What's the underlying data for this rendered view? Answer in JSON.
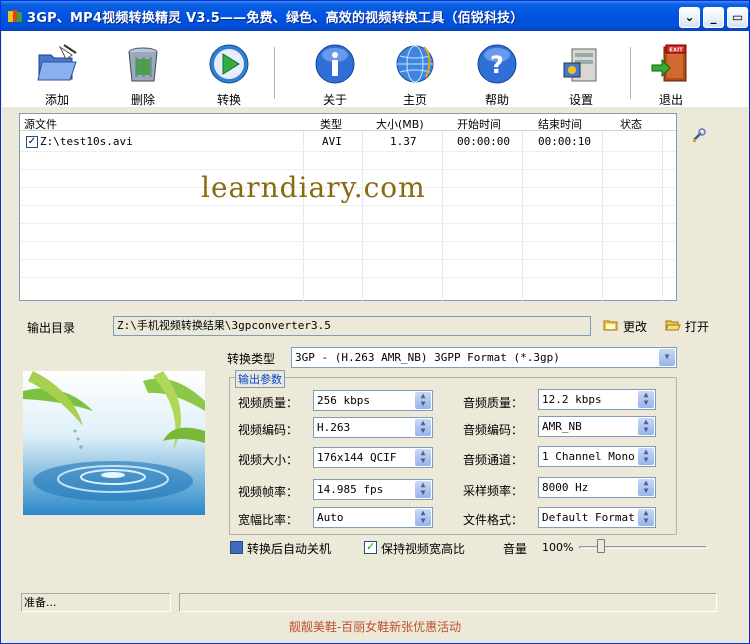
{
  "window": {
    "title": "3GP、MP4视频转换精灵 V3.5——免费、绿色、高效的视频转换工具（佰锐科技）",
    "controls": [
      "chevron-down",
      "minimize",
      "close"
    ]
  },
  "toolbar": {
    "add_label": "添加",
    "delete_label": "删除",
    "convert_label": "转换",
    "about_label": "关于",
    "home_label": "主页",
    "help_label": "帮助",
    "settings_label": "设置",
    "exit_label": "退出",
    "exit_badge": "EXIT"
  },
  "file_list": {
    "columns": [
      "源文件",
      "类型",
      "大小(MB)",
      "开始时间",
      "结束时间",
      "状态"
    ],
    "rows": [
      {
        "checked": true,
        "file": "Z:\\test10s.avi",
        "type": "AVI",
        "size": "1.37",
        "start": "00:00:00",
        "end": "00:00:10",
        "status": ""
      }
    ]
  },
  "watermark": "learndiary.com",
  "output": {
    "label": "输出目录",
    "path": "Z:\\手机视频转换结果\\3gpconverter3.5",
    "change_label": "更改",
    "open_label": "打开"
  },
  "convert_type": {
    "label": "转换类型",
    "value": "3GP - (H.263 AMR_NB) 3GPP Format (*.3gp)"
  },
  "params": {
    "group_title": "输出参数",
    "video_quality_label": "视频质量：",
    "video_quality": "256 kbps",
    "video_codec_label": "视频编码：",
    "video_codec": "H.263",
    "video_size_label": "视频大小：",
    "video_size": "176x144 QCIF",
    "video_fps_label": "视频帧率：",
    "video_fps": "14.985 fps",
    "aspect_label": "宽幅比率：",
    "aspect": "Auto",
    "audio_quality_label": "音频质量：",
    "audio_quality": "12.2  kbps",
    "audio_codec_label": "音频编码：",
    "audio_codec": "AMR_NB",
    "audio_channel_label": "音频通道：",
    "audio_channel": "1 Channel Mono",
    "sample_rate_label": "采样频率：",
    "sample_rate": "8000  Hz",
    "file_format_label": "文件格式：",
    "file_format": "Default Format"
  },
  "options": {
    "shutdown_label": "转换后自动关机",
    "shutdown_checked": false,
    "keep_ratio_label": "保持视频宽高比",
    "keep_ratio_checked": true,
    "volume_label": "音量",
    "volume_value": "100%",
    "volume_level": 0.14
  },
  "status": {
    "text": "准备...",
    "progress": 0
  },
  "ad_text": "靓靓美鞋-百丽女鞋新张优惠活动",
  "colors": {
    "titlebar": "#0054e3",
    "window_bg": "#ece9d8",
    "ad_text": "#c05030",
    "group_title": "#0046d5"
  }
}
